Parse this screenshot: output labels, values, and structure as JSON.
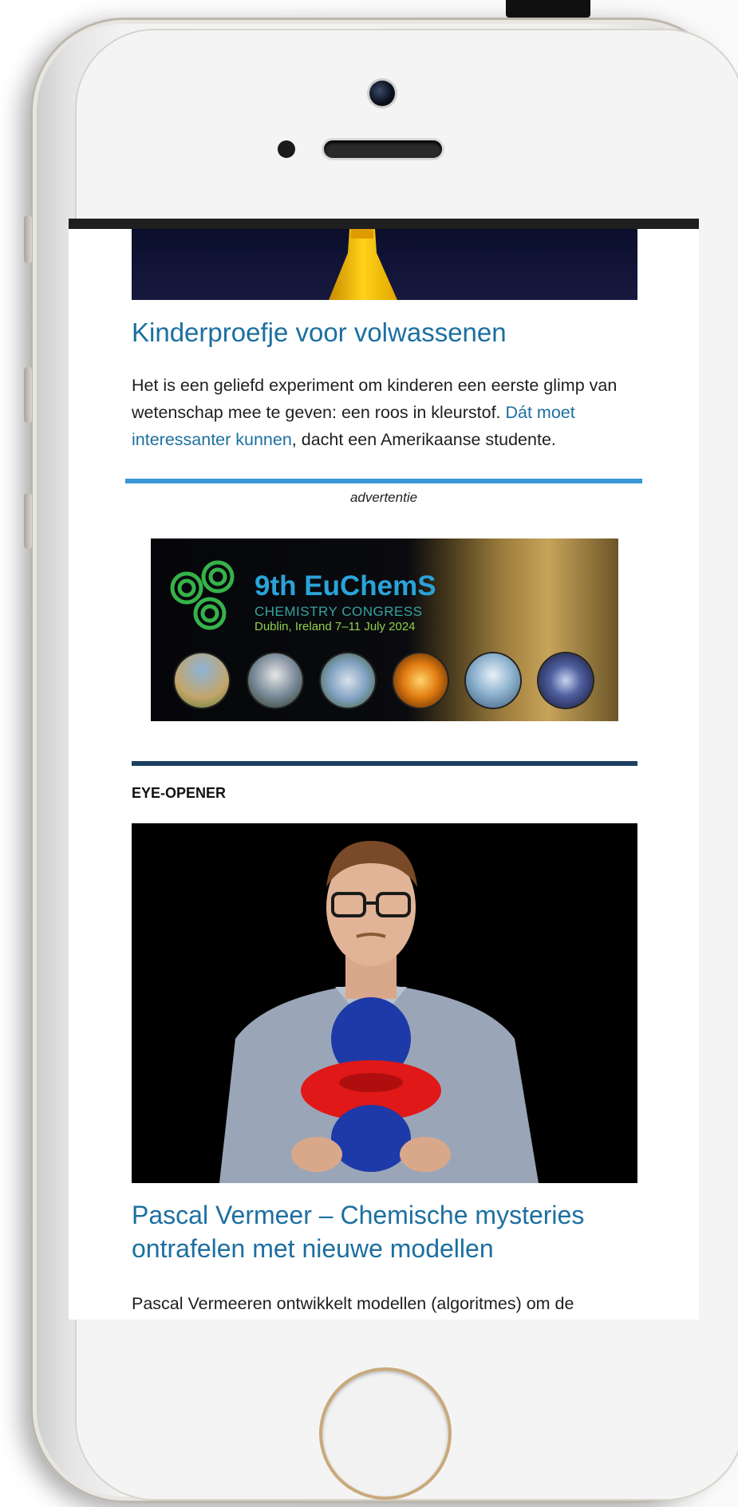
{
  "article1": {
    "title": "Kinderproefje voor volwassenen",
    "body_start": "Het is een geliefd experiment om kinderen een eerste glimp van wetenschap mee te geven: een roos in kleurstof. ",
    "body_link": "Dát moet interessanter kunnen",
    "body_end": ", dacht een Amerikaanse studente."
  },
  "advert": {
    "label": "advertentie",
    "banner_title": "9th EuChemS",
    "banner_subtitle": "CHEMISTRY CONGRESS",
    "banner_location": "Dublin, Ireland 7–11 July 2024"
  },
  "section": {
    "label": "EYE-OPENER"
  },
  "article2": {
    "title": "Pascal Vermeer – Chemische mysteries ontrafelen met nieuwe modellen",
    "body": "Pascal Vermeeren ontwikkelt modellen (algoritmes) om de"
  },
  "colors": {
    "link": "#1c6fa0",
    "ad_rule": "#3a97d4",
    "section_rule": "#1b3f63"
  }
}
